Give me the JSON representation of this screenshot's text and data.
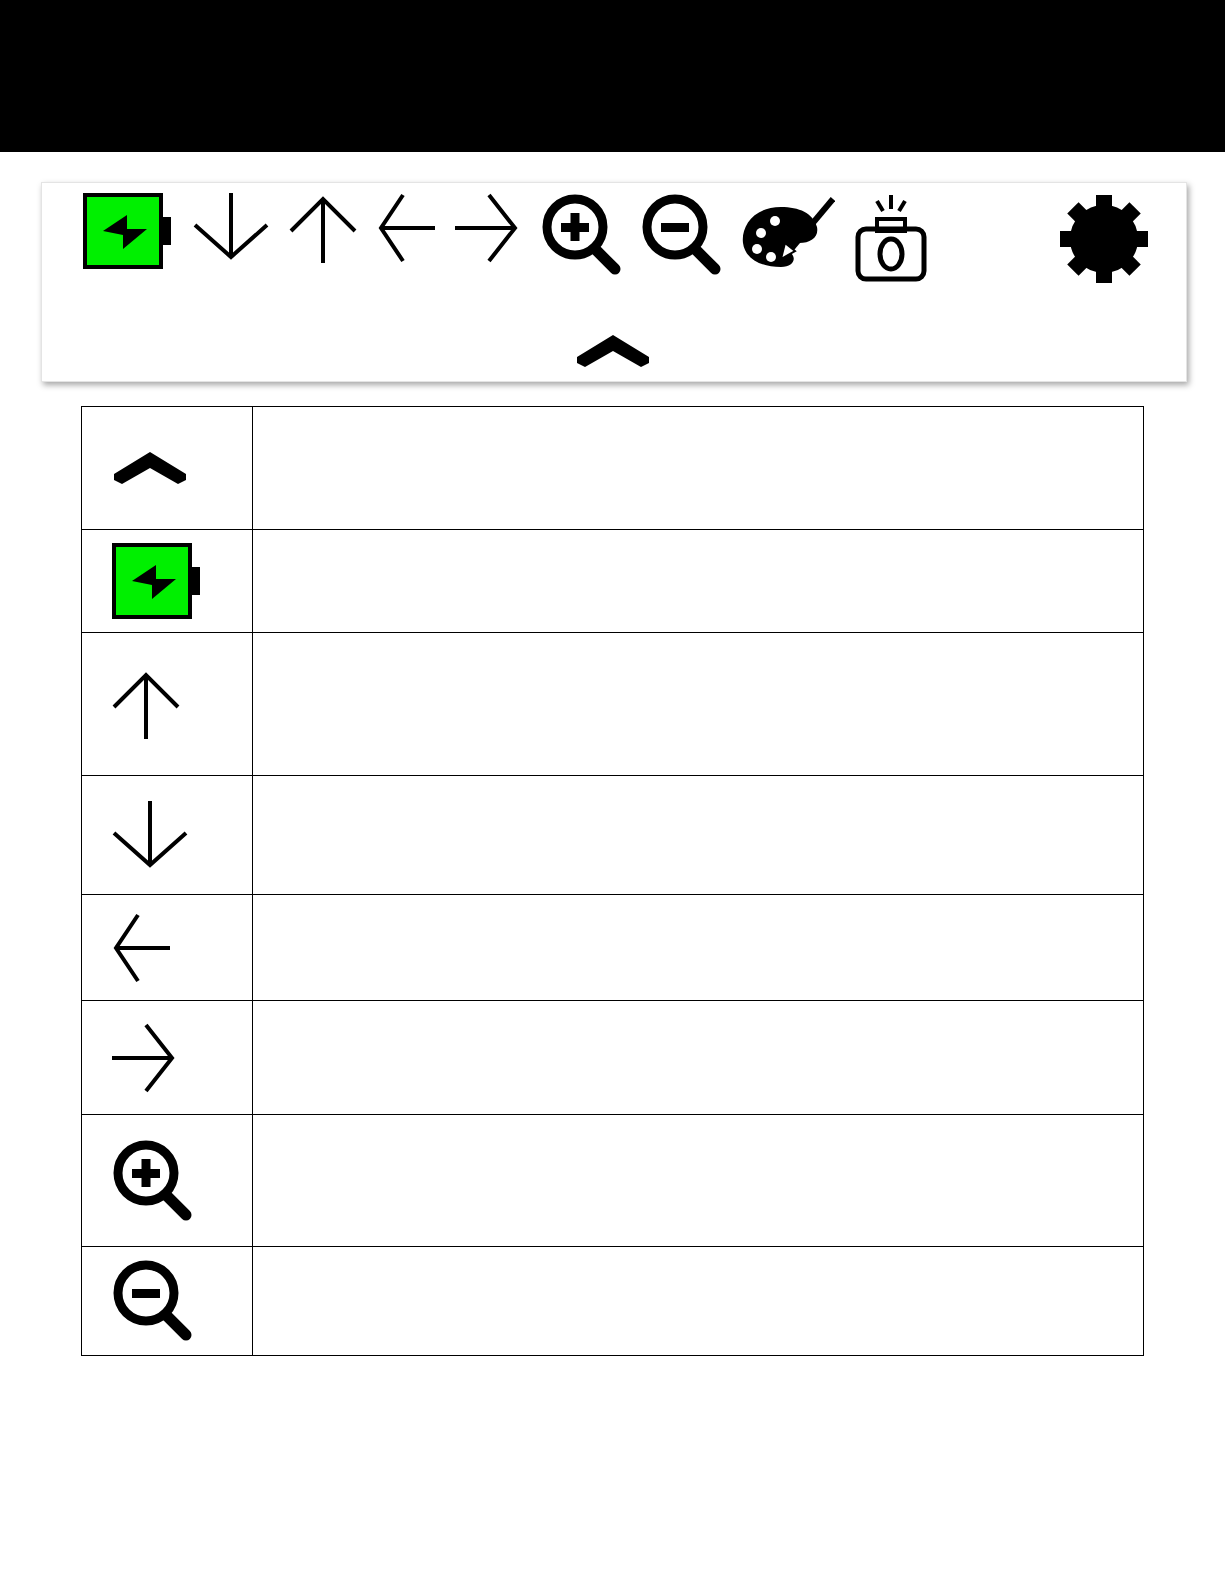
{
  "toolbar": {
    "items": [
      {
        "kind": "battery"
      },
      {
        "kind": "arrow-down"
      },
      {
        "kind": "arrow-up"
      },
      {
        "kind": "arrow-left"
      },
      {
        "kind": "arrow-right"
      },
      {
        "kind": "zoom-in"
      },
      {
        "kind": "zoom-out"
      },
      {
        "kind": "palette"
      },
      {
        "kind": "camera"
      },
      {
        "kind": "settings"
      }
    ],
    "collapse": {
      "kind": "chevron-up"
    }
  },
  "table": {
    "rows": [
      {
        "kind": "chevron-up"
      },
      {
        "kind": "battery"
      },
      {
        "kind": "arrow-up"
      },
      {
        "kind": "arrow-down"
      },
      {
        "kind": "arrow-left"
      },
      {
        "kind": "arrow-right"
      },
      {
        "kind": "zoom-in"
      },
      {
        "kind": "zoom-out"
      }
    ]
  }
}
